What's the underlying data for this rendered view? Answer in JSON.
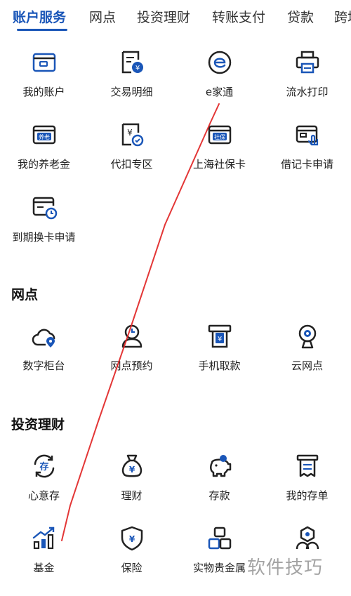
{
  "tabs": [
    "账户服务",
    "网点",
    "投资理财",
    "转账支付",
    "贷款",
    "跨境"
  ],
  "account_services": [
    {
      "label": "我的账户",
      "icon": "card-icon"
    },
    {
      "label": "交易明细",
      "icon": "receipt-yuan-icon"
    },
    {
      "label": "e家通",
      "icon": "e-circle-icon"
    },
    {
      "label": "流水打印",
      "icon": "printer-icon"
    },
    {
      "label": "我的养老金",
      "icon": "pension-card-icon",
      "icon_text": "养老"
    },
    {
      "label": "代扣专区",
      "icon": "withhold-yuan-icon"
    },
    {
      "label": "上海社保卡",
      "icon": "social-security-card-icon",
      "icon_text": "社保"
    },
    {
      "label": "借记卡申请",
      "icon": "debit-card-apply-icon"
    },
    {
      "label": "到期换卡申请",
      "icon": "card-renew-clock-icon"
    }
  ],
  "outlets": {
    "title": "网点",
    "items": [
      {
        "label": "数字柜台",
        "icon": "cloud-location-icon"
      },
      {
        "label": "网点预约",
        "icon": "clock-person-icon"
      },
      {
        "label": "手机取款",
        "icon": "atm-yuan-icon"
      },
      {
        "label": "云网点",
        "icon": "camera-icon"
      }
    ]
  },
  "investment": {
    "title": "投资理财",
    "items": [
      {
        "label": "心意存",
        "icon": "deposit-cycle-icon",
        "icon_text": "存"
      },
      {
        "label": "理财",
        "icon": "money-bag-icon"
      },
      {
        "label": "存款",
        "icon": "piggy-bank-icon"
      },
      {
        "label": "我的存单",
        "icon": "certificate-icon"
      },
      {
        "label": "基金",
        "icon": "fund-chart-icon"
      },
      {
        "label": "保险",
        "icon": "shield-icon"
      },
      {
        "label": "实物贵金属",
        "icon": "gold-bars-icon"
      },
      {
        "label": "",
        "icon": "hexagon-people-icon"
      }
    ]
  },
  "watermark": "软件技巧",
  "colors": {
    "primary": "#1a56b8",
    "text": "#222222",
    "annotation": "#e02020"
  }
}
